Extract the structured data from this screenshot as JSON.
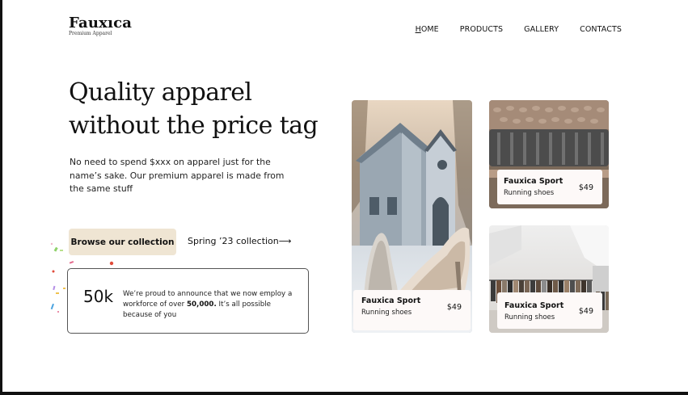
{
  "brand": {
    "name": "Fauxıca",
    "tagline": "Premium Apparel"
  },
  "nav": {
    "items": [
      {
        "first": "H",
        "rest": "OME",
        "active": true
      },
      {
        "first": "P",
        "rest": "RODUCTS",
        "active": false
      },
      {
        "first": "G",
        "rest": "ALLERY",
        "active": false
      },
      {
        "first": "C",
        "rest": "ONTACTS",
        "active": false
      }
    ]
  },
  "hero": {
    "title_line1": "Quality apparel",
    "title_line2": "without the price tag",
    "description": "No need to spend $xxx on apparel just for the name’s sake. Our premium apparel is made from the same stuff",
    "primary_button": "Browse our collection",
    "secondary_link": "Spring  ’23 collection⟶"
  },
  "stat": {
    "number": "50k",
    "text_before": "We’re proud to announce that we now employ a workforce of over ",
    "text_bold": "50,000.",
    "text_after": " It’s all  possible because of you"
  },
  "products": [
    {
      "name": "Fauxica Sport",
      "subtitle": "Running shoes",
      "price": "$49",
      "image": "heels-church-photo"
    },
    {
      "name": "Fauxica Sport",
      "subtitle": "Running shoes",
      "price": "$49",
      "image": "knit-sweaters-photo"
    },
    {
      "name": "Fauxica Sport",
      "subtitle": "Running shoes",
      "price": "$49",
      "image": "clothing-rack-photo"
    }
  ],
  "colors": {
    "button_bg": "#efe5d3",
    "text": "#111111",
    "label_bg": "#fdf9f8"
  }
}
